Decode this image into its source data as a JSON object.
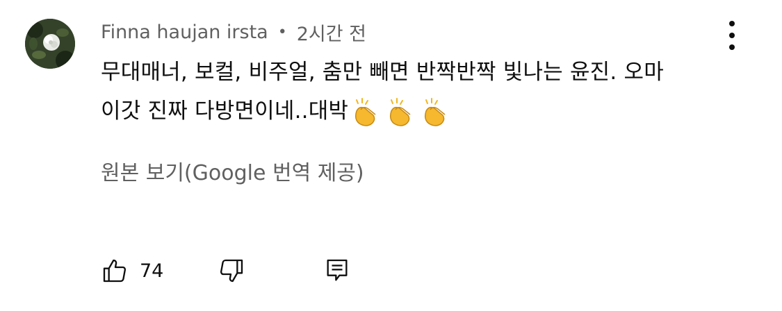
{
  "comment": {
    "author": "Finna haujan irsta",
    "separator": "•",
    "time": "2시간 전",
    "lines": [
      "무대매너, 보컬, 비주얼, 춤만 빼면 반짝반짝 빛나는 윤진. 오마",
      "이갓 진짜 다방면이네..대박"
    ],
    "emoji": [
      "clapping-hands",
      "clapping-hands",
      "clapping-hands"
    ],
    "translate_link": "원본 보기(Google 번역 제공)"
  },
  "actions": {
    "like_count": "74"
  },
  "icons": {
    "like": "thumbs-up-icon",
    "dislike": "thumbs-down-icon",
    "reply": "comment-icon",
    "more": "more-vertical-icon"
  },
  "colors": {
    "text_primary": "#0f0f0f",
    "text_secondary": "#606060",
    "background": "#ffffff"
  }
}
